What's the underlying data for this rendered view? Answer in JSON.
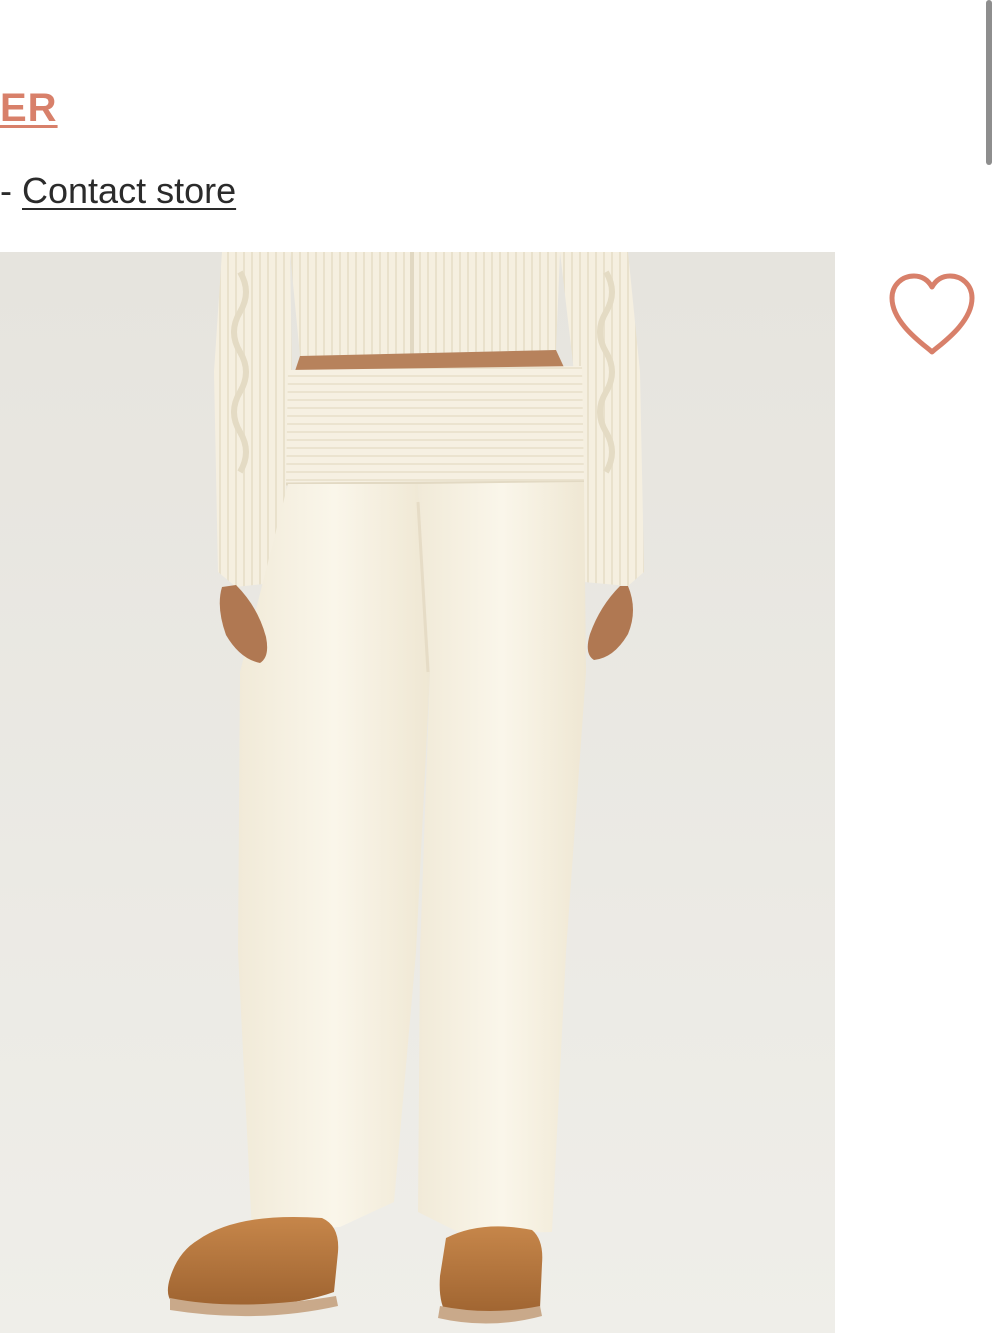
{
  "header": {
    "seller_link_text": "ER",
    "contact_dash": "- ",
    "contact_link_text": "Contact store"
  },
  "product": {
    "image_alt": "Model wearing cream ribbed knit fold-over waist flare pants with matching cream cable knit zip cardigan and tan suede boots",
    "favorite_icon": "heart-outline-icon"
  },
  "colors": {
    "accent": "#d8806a",
    "text": "#2b2b2b",
    "photo_bg": "#e8e7e2",
    "garment": "#f7f2e4",
    "boots": "#b9773d"
  }
}
